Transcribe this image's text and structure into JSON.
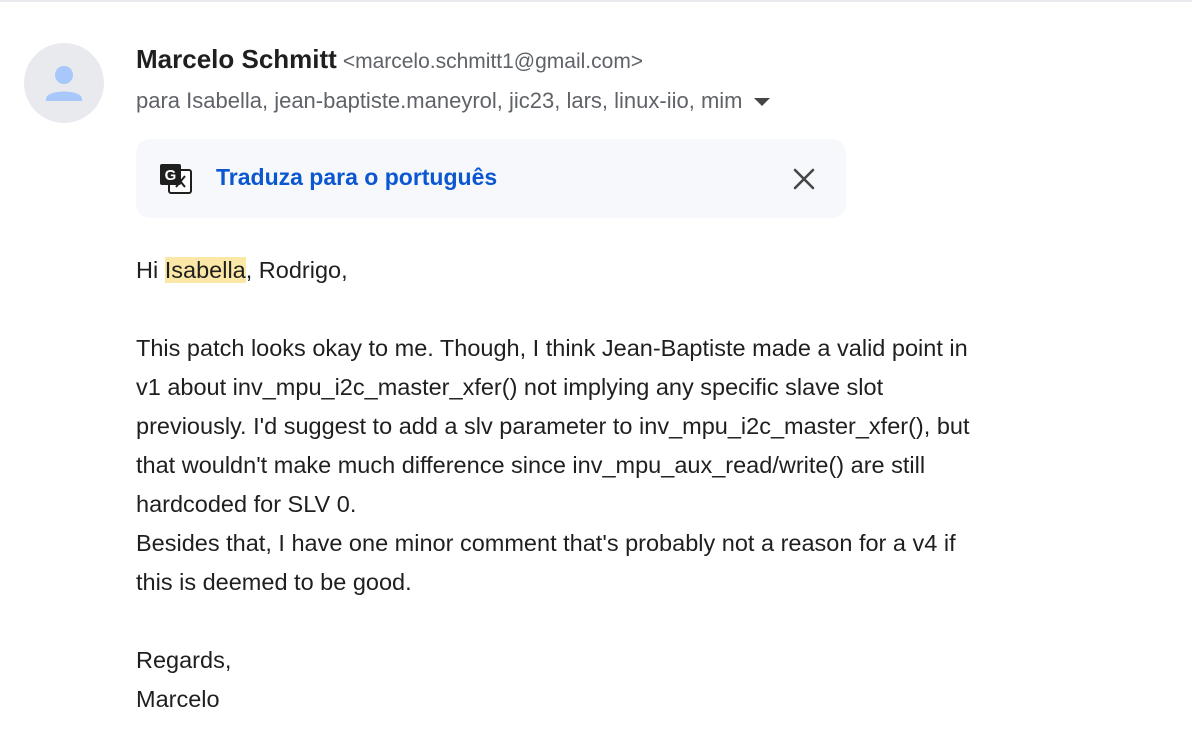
{
  "sender": {
    "name": "Marcelo Schmitt",
    "email": "<marcelo.schmitt1@gmail.com>",
    "recipients": "para Isabella, jean-baptiste.maneyrol, jic23, lars, linux-iio, mim"
  },
  "translate_bar": {
    "link_label": "Traduza para o português",
    "icon": "google-translate-icon",
    "close_icon": "close-icon"
  },
  "body": {
    "greeting_prefix": "Hi ",
    "greeting_highlight": "Isabella",
    "greeting_suffix": ", Rodrigo,",
    "paragraph1_line1": "This patch looks okay to me. Though, I think Jean-Baptiste made a valid point in",
    "paragraph1_line2": "v1 about inv_mpu_i2c_master_xfer() not implying any specific slave slot",
    "paragraph1_line3": "previously. I'd suggest to add a slv parameter to inv_mpu_i2c_master_xfer(), but",
    "paragraph1_line4": "that wouldn't make much difference since inv_mpu_aux_read/write() are still",
    "paragraph1_line5": "hardcoded for SLV 0.",
    "paragraph2_line1": "Besides that, I have one minor comment that's probably not a reason for a v4 if",
    "paragraph2_line2": "this is deemed to be good.",
    "signoff": "Regards,",
    "signature": "Marcelo"
  },
  "colors": {
    "link": "#0b57d0",
    "highlight": "#fce8a6",
    "secondary_text": "#5f6368",
    "translate_bar_bg": "#f6f8fc"
  }
}
